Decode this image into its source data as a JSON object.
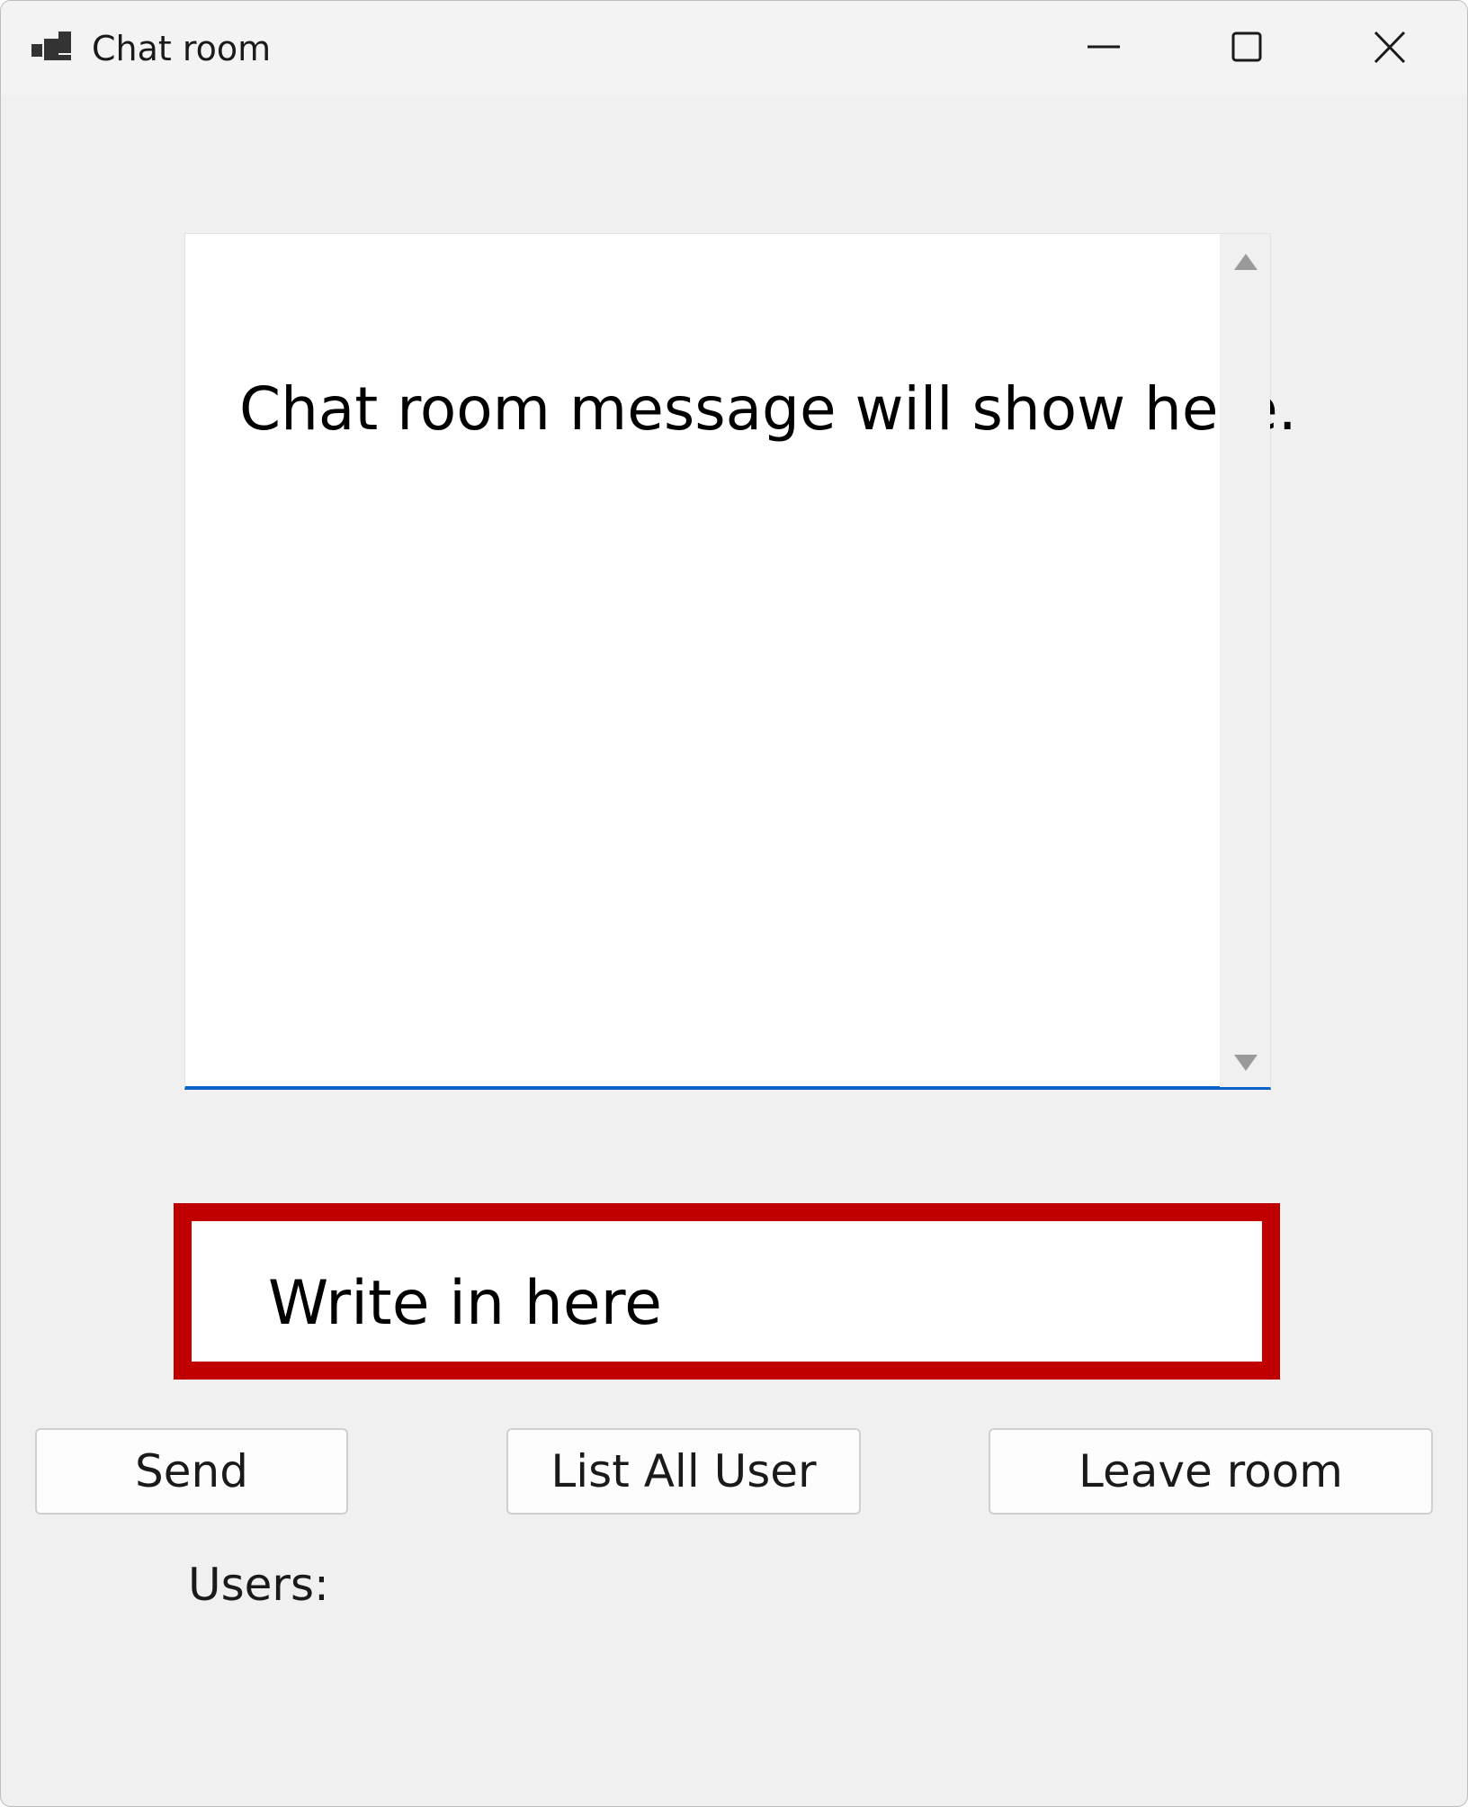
{
  "window": {
    "title": "Chat room",
    "app_icon": "app-window-icon",
    "controls": {
      "minimize_icon": "minimize-icon",
      "maximize_icon": "maximize-icon",
      "close_icon": "close-icon"
    }
  },
  "messages": {
    "placeholder_text": "Chat room message will show here.",
    "accent_color": "#0a64c8"
  },
  "input": {
    "text": "Write in here",
    "highlight_color": "#c00000"
  },
  "buttons": {
    "send_label": "Send",
    "list_users_label": "List All User",
    "leave_label": "Leave room"
  },
  "users": {
    "label": "Users:"
  }
}
